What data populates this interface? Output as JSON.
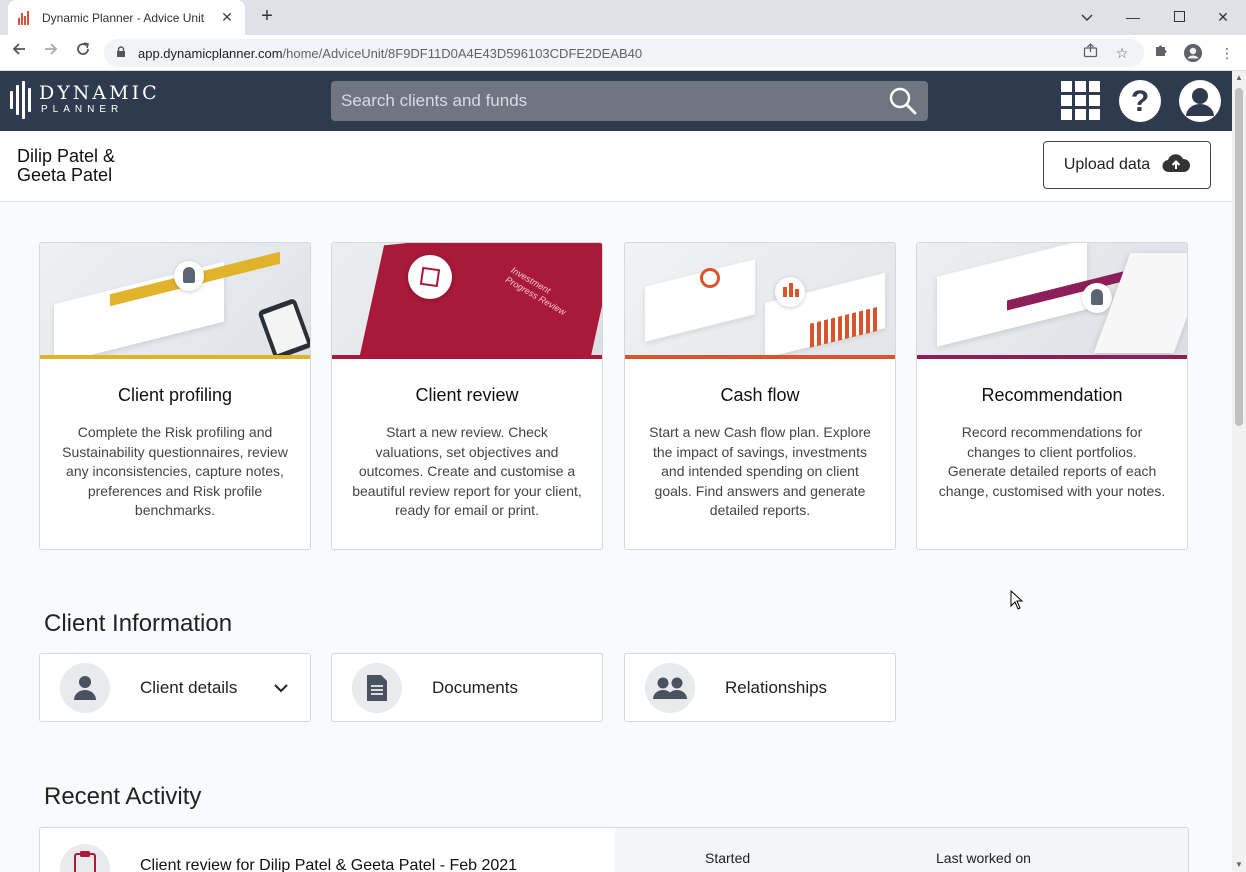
{
  "browser": {
    "tab_title": "Dynamic Planner - Advice Unit",
    "url_host": "app.dynamicplanner.com",
    "url_path": "/home/AdviceUnit/8F9DF11D0A4E43D596103CDFE2DEAB40"
  },
  "header": {
    "logo_line1": "DYNAMIC",
    "logo_line2": "PLANNER",
    "search_placeholder": "Search clients and funds"
  },
  "client": {
    "name": "Dilip Patel & Geeta Patel",
    "upload_label": "Upload data"
  },
  "cards": [
    {
      "title": "Client profiling",
      "description": "Complete the Risk profiling and Sustainability questionnaires, review any inconsistencies, capture notes, preferences and Risk profile benchmarks.",
      "accent": "#e0b32a"
    },
    {
      "title": "Client review",
      "description": "Start a new review. Check valuations, set objectives and outcomes. Create and customise a beautiful review report for your client, ready for email or print.",
      "accent": "#a8193a",
      "image_text": "Investment Progress Review"
    },
    {
      "title": "Cash flow",
      "description": "Start a new Cash flow plan. Explore the impact of savings, investments and intended spending on client goals. Find answers and generate detailed reports.",
      "accent": "#d9542b"
    },
    {
      "title": "Recommendation",
      "description": "Record recommendations for changes to client portfolios. Generate detailed reports of each change, customised with your notes.",
      "accent": "#8e1e5a"
    }
  ],
  "client_information": {
    "title": "Client Information",
    "items": [
      {
        "label": "Client details"
      },
      {
        "label": "Documents"
      },
      {
        "label": "Relationships"
      }
    ]
  },
  "recent_activity": {
    "title": "Recent Activity",
    "items": [
      {
        "title": "Client review for Dilip Patel & Geeta Patel - Feb 2021",
        "started_label": "Started",
        "last_worked_label": "Last worked on"
      }
    ]
  }
}
